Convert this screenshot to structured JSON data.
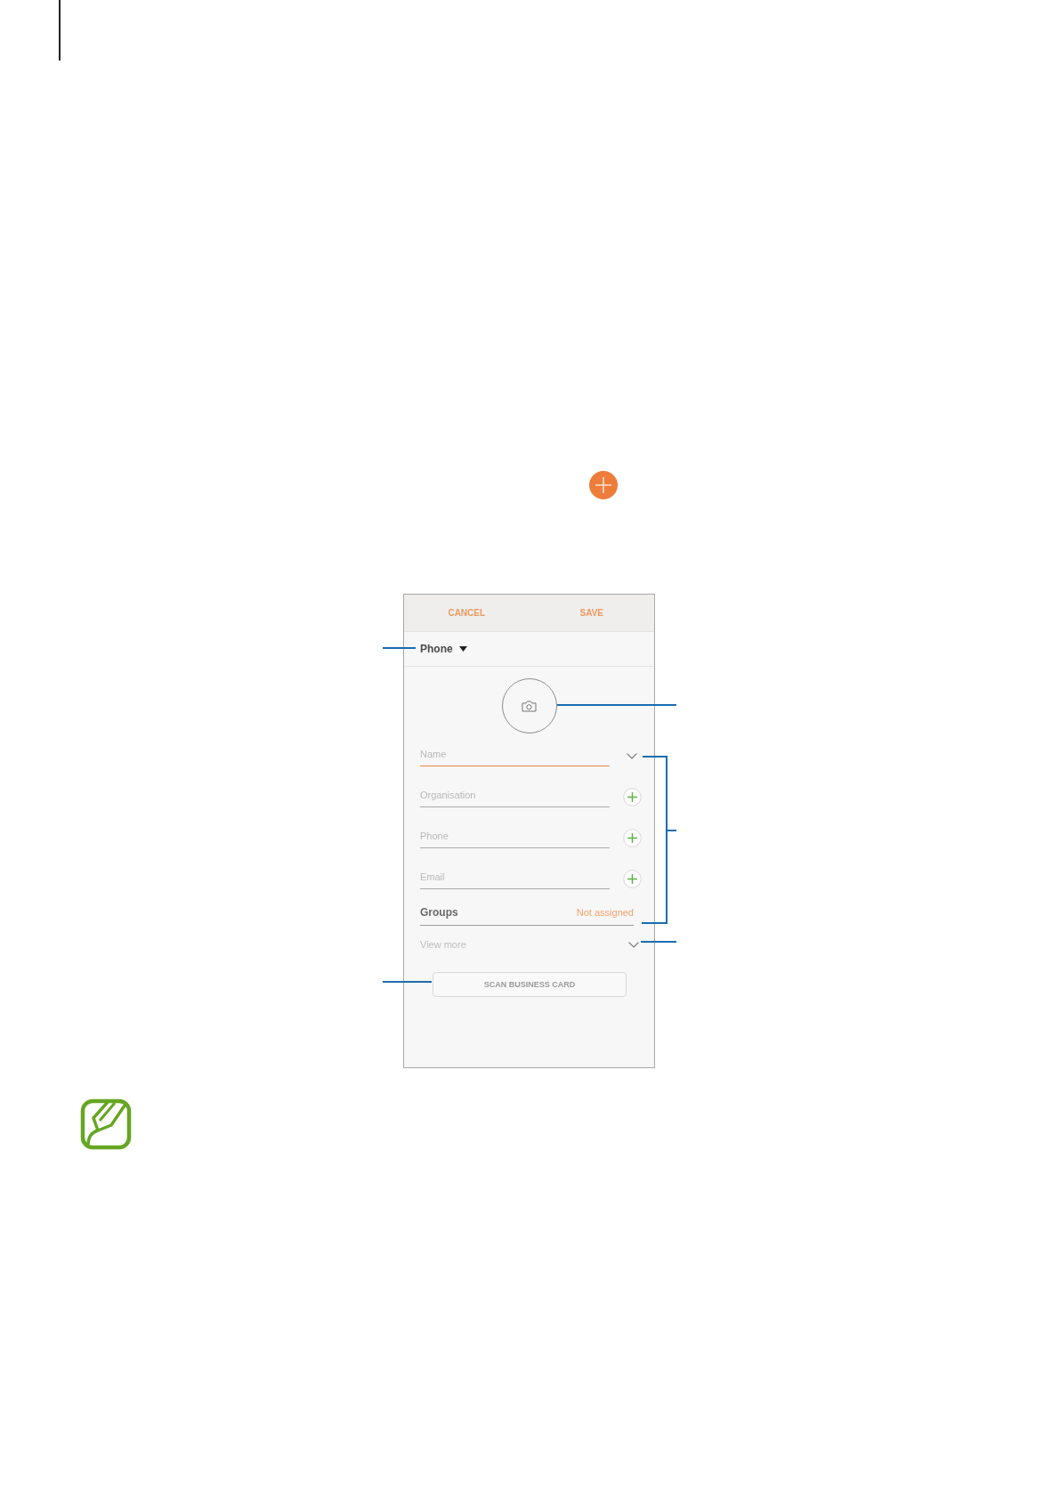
{
  "screenshot": {
    "action_bar": [
      {
        "label": "CANCEL"
      },
      {
        "label": "SAVE"
      }
    ],
    "storage": {
      "label": "Phone"
    },
    "fields": [
      {
        "placeholder": "Name",
        "kind": "expand",
        "focused": true
      },
      {
        "placeholder": "Organisation",
        "kind": "add",
        "focused": false
      },
      {
        "placeholder": "Phone",
        "kind": "add",
        "focused": false
      },
      {
        "placeholder": "Email",
        "kind": "add",
        "focused": false
      }
    ],
    "groups": {
      "label": "Groups",
      "value": "Not assigned"
    },
    "view_more": {
      "label": "View more"
    },
    "scan_button": {
      "label": "SCAN BUSINESS CARD"
    }
  }
}
